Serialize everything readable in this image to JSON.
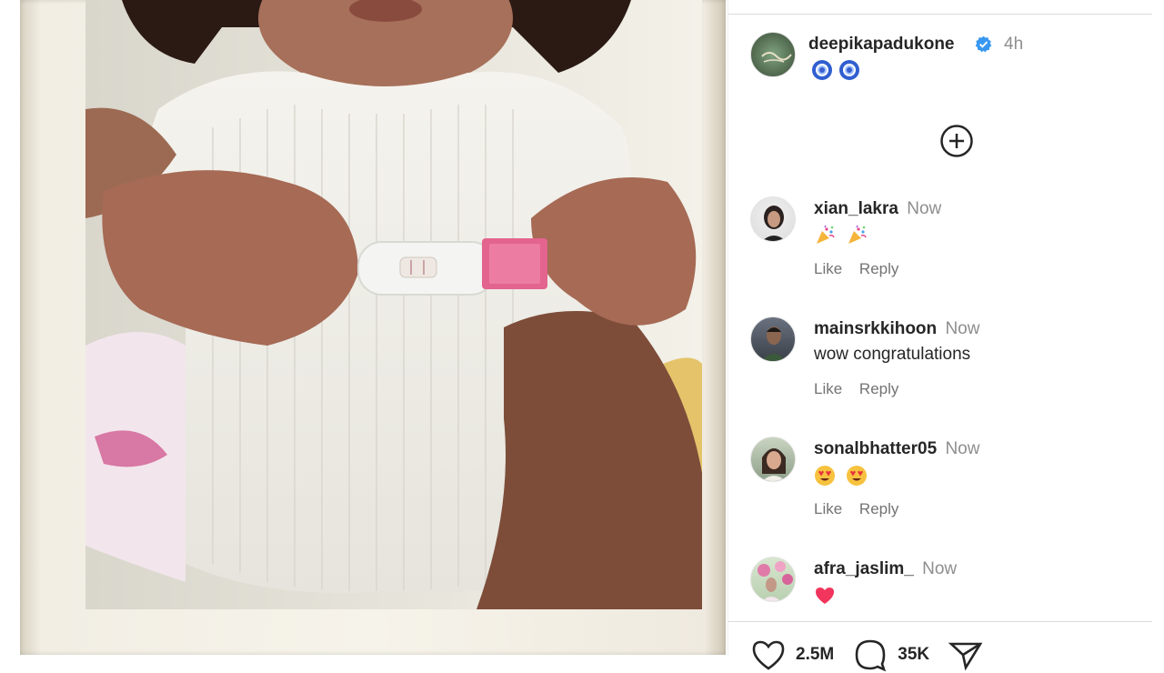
{
  "post": {
    "author": "deepikapadukone",
    "time": "4h",
    "caption_emoji": [
      "nazar-amulet-icon",
      "nazar-amulet-icon"
    ]
  },
  "load_more_icon": "plus-circle-icon",
  "comments": [
    {
      "user": "xian_lakra",
      "time": "Now",
      "text": "",
      "emoji": [
        "party-popper-icon",
        "party-popper-icon"
      ],
      "like": "Like",
      "reply": "Reply"
    },
    {
      "user": "mainsrkkihoon",
      "time": "Now",
      "text": "wow congratulations",
      "emoji": [],
      "like": "Like",
      "reply": "Reply"
    },
    {
      "user": "sonalbhatter05",
      "time": "Now",
      "text": "",
      "emoji": [
        "heart-eyes-icon",
        "heart-eyes-icon"
      ],
      "like": "Like",
      "reply": "Reply"
    },
    {
      "user": "afra_jaslim_",
      "time": "Now",
      "text": "",
      "emoji": [
        "red-heart-icon"
      ],
      "like": "",
      "reply": ""
    }
  ],
  "actions": {
    "likes": "2.5M",
    "comments": "35K"
  },
  "colors": {
    "verified": "#3897f0",
    "muted": "#8e8e8e",
    "text": "#262626"
  }
}
